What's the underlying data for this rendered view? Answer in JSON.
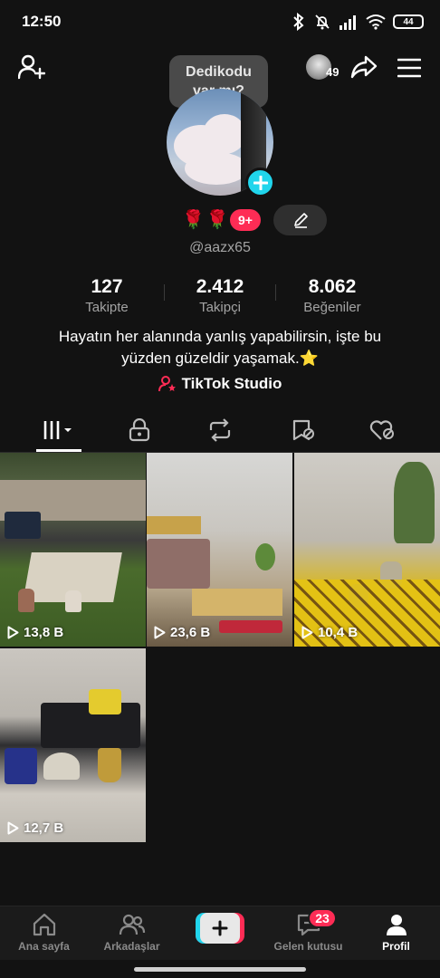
{
  "status_bar": {
    "time": "12:50",
    "battery": "44",
    "icons": [
      "bluetooth-icon",
      "mute-icon",
      "signal-icon",
      "wifi-icon",
      "battery-icon"
    ]
  },
  "top_bar": {
    "icons": [
      "add-friend-icon",
      "share-icon",
      "menu-icon"
    ],
    "viewer_count": "49",
    "bubble_line1": "Dedikodu",
    "bubble_line2": "var mı?"
  },
  "profile": {
    "roses": "🌹🌹",
    "badge_count": "9+",
    "username": "@aazx65",
    "bio_line1": "Hayatın her alanında yanlış yapabilirsin, işte bu",
    "bio_line2": "yüzden güzeldir yaşamak.⭐",
    "studio_label": "TikTok Studio"
  },
  "stats": [
    {
      "value": "127",
      "label": "Takipte"
    },
    {
      "value": "2.412",
      "label": "Takipçi"
    },
    {
      "value": "8.062",
      "label": "Beğeniler"
    }
  ],
  "tabs": [
    "videos-grid-icon",
    "lock-icon",
    "repost-icon",
    "favorites-icon",
    "liked-icon"
  ],
  "videos": [
    {
      "views": "13,8 B"
    },
    {
      "views": "23,6 B"
    },
    {
      "views": "10,4 B"
    },
    {
      "views": "12,7 B"
    }
  ],
  "nav": {
    "home": "Ana sayfa",
    "friends": "Arkadaşlar",
    "inbox": "Gelen kutusu",
    "inbox_badge": "23",
    "profile": "Profil"
  },
  "colors": {
    "accent_pink": "#fe2c55",
    "accent_cyan": "#20d5ec",
    "background": "#121212"
  }
}
